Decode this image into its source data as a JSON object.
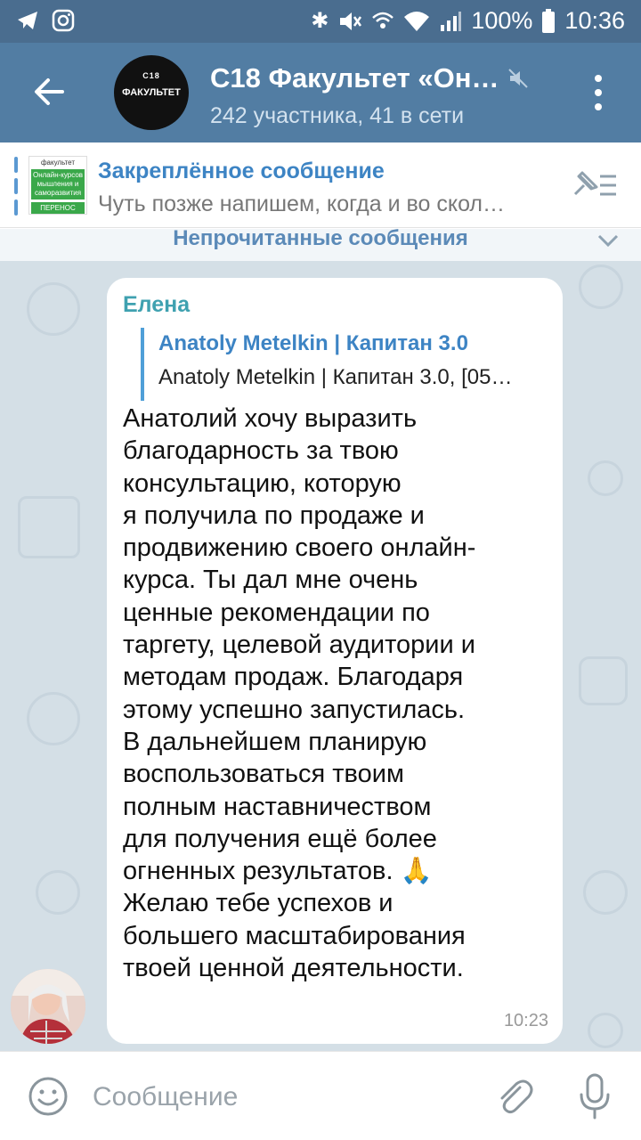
{
  "status_bar": {
    "battery": "100%",
    "time": "10:36"
  },
  "header": {
    "chat_title": "C18 Факультет «Он…",
    "subtitle": "242 участника, 41 в сети",
    "avatar_line1": "C18",
    "avatar_line2": "ФАКУЛЬТЕТ"
  },
  "pinned": {
    "title": "Закреплённое сообщение",
    "text": "Чуть позже напишем, когда и во скол…",
    "thumb_line1": "факультет",
    "thumb_line2": "Онлайн-курсов мышления и саморазвития",
    "thumb_line3": "ПЕРЕНОС"
  },
  "unread_label": "Непрочитанные сообщения",
  "message": {
    "sender": "Елена",
    "reply_title": "Anatoly Metelkin | Капитан 3.0",
    "reply_text": "Anatoly Metelkin | Капитан 3.0, [05…",
    "text": "Анатолий хочу выразить\nблагодарность за твою\nконсультацию, которую\nя получила по продаже и\nпродвижению своего онлайн-\nкурса. Ты дал мне очень\nценные рекомендации по\nтаргету, целевой аудитории и\nметодам продаж. Благодаря\nэтому успешно запустилась.\nВ дальнейшем планирую\nвоспользоваться твоим\nполным наставничеством\nдля получения ещё более\nогненных результатов. 🙏\nЖелаю тебе успехов и\nбольшего масштабирования\nтвоей ценной деятельности.",
    "time": "10:23"
  },
  "input": {
    "placeholder": "Сообщение"
  },
  "colors": {
    "status_bar": "#4a6d8f",
    "app_bar": "#527da3",
    "accent": "#3d84c4",
    "sender": "#3fa1b0",
    "chat_bg": "#d4dfe6"
  },
  "icons": [
    "back-arrow-icon",
    "mute-icon",
    "more-vert-icon",
    "pinned-list-icon",
    "chevron-down-icon",
    "emoji-icon",
    "attach-icon",
    "mic-icon"
  ]
}
